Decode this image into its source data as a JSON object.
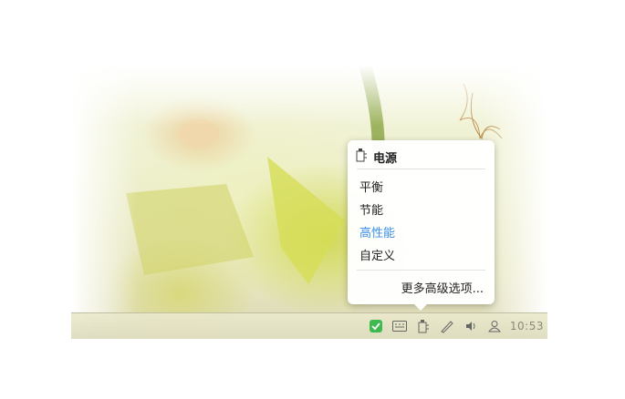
{
  "power_menu": {
    "title": "电源",
    "options": [
      {
        "label": "平衡",
        "selected": false
      },
      {
        "label": "节能",
        "selected": false
      },
      {
        "label": "高性能",
        "selected": true
      },
      {
        "label": "自定义",
        "selected": false
      }
    ],
    "more_label": "更多高级选项..."
  },
  "taskbar": {
    "clock": "10:53",
    "tray_icons": [
      "security-check-icon",
      "keyboard-icon",
      "power-plug-icon",
      "pen-icon",
      "volume-icon",
      "user-icon"
    ]
  },
  "colors": {
    "selected_text": "#3b8ee8",
    "security_green": "#3fb950"
  }
}
